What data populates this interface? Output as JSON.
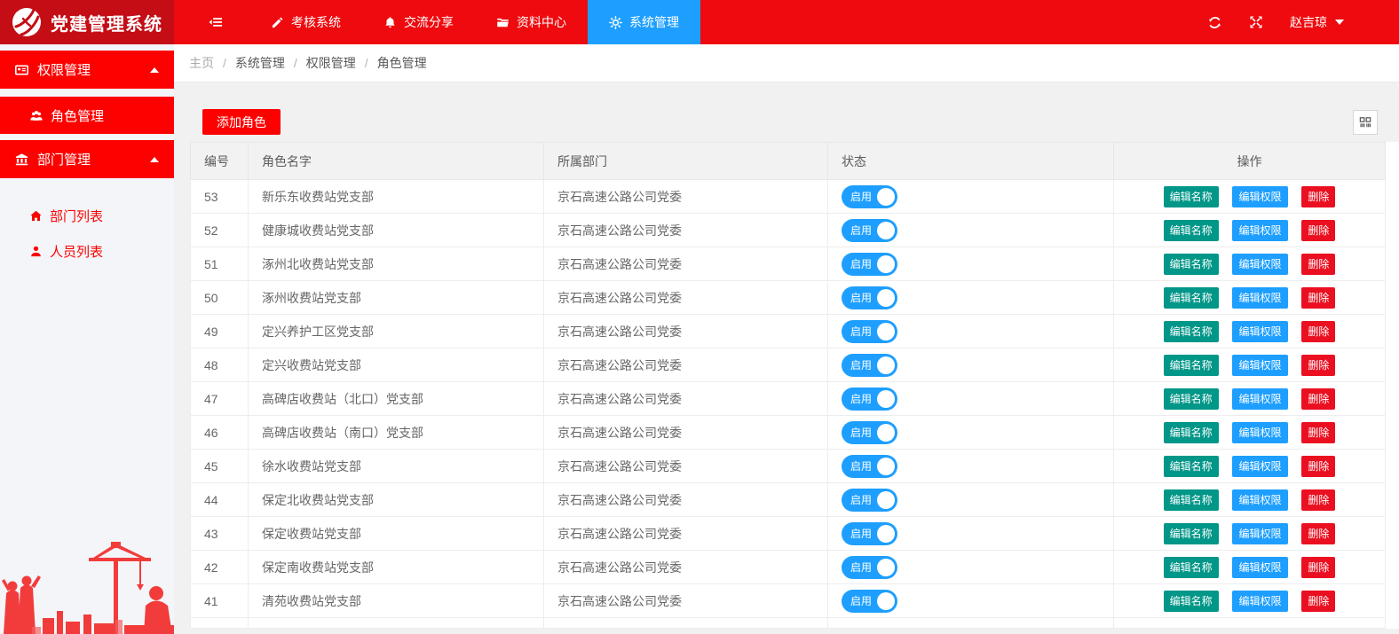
{
  "app": {
    "title": "党建管理系统"
  },
  "colors": {
    "nav_red": "#ee0a0e",
    "logo_red": "#c40d15",
    "menu_red": "#fd0100",
    "active_blue": "#1e9fff",
    "action_green": "#009688",
    "delete_red": "#ea1021"
  },
  "topnav": {
    "items": [
      {
        "label": "考核系统",
        "icon": "pencil-icon",
        "active": false
      },
      {
        "label": "交流分享",
        "icon": "bell-icon",
        "active": false
      },
      {
        "label": "资料中心",
        "icon": "folder-icon",
        "active": false
      },
      {
        "label": "系统管理",
        "icon": "gears-icon",
        "active": true
      }
    ],
    "user": "赵吉琼"
  },
  "sidebar": {
    "groups": [
      {
        "label": "权限管理",
        "icon": "permission-card-icon",
        "expanded": true,
        "children": [
          {
            "label": "角色管理",
            "icon": "users-icon",
            "active": true
          }
        ]
      },
      {
        "label": "部门管理",
        "icon": "bank-icon",
        "expanded": true,
        "children": [
          {
            "label": "部门列表",
            "icon": "home-icon",
            "active": false
          },
          {
            "label": "人员列表",
            "icon": "person-icon",
            "active": false
          }
        ]
      }
    ]
  },
  "breadcrumb": {
    "separator": "/",
    "items": [
      "主页",
      "系统管理",
      "权限管理",
      "角色管理"
    ]
  },
  "toolbar": {
    "add_button": "添加角色"
  },
  "table": {
    "headers": [
      "编号",
      "角色名字",
      "所属部门",
      "状态",
      "操作"
    ],
    "status_on_label": "启用",
    "actions": [
      "编辑名称",
      "编辑权限",
      "删除"
    ],
    "rows": [
      {
        "id": "53",
        "name": "新乐东收费站党支部",
        "dept": "京石高速公路公司党委"
      },
      {
        "id": "52",
        "name": "健康城收费站党支部",
        "dept": "京石高速公路公司党委"
      },
      {
        "id": "51",
        "name": "涿州北收费站党支部",
        "dept": "京石高速公路公司党委"
      },
      {
        "id": "50",
        "name": "涿州收费站党支部",
        "dept": "京石高速公路公司党委"
      },
      {
        "id": "49",
        "name": "定兴养护工区党支部",
        "dept": "京石高速公路公司党委"
      },
      {
        "id": "48",
        "name": "定兴收费站党支部",
        "dept": "京石高速公路公司党委"
      },
      {
        "id": "47",
        "name": "高碑店收费站（北口）党支部",
        "dept": "京石高速公路公司党委"
      },
      {
        "id": "46",
        "name": "高碑店收费站（南口）党支部",
        "dept": "京石高速公路公司党委"
      },
      {
        "id": "45",
        "name": "徐水收费站党支部",
        "dept": "京石高速公路公司党委"
      },
      {
        "id": "44",
        "name": "保定北收费站党支部",
        "dept": "京石高速公路公司党委"
      },
      {
        "id": "43",
        "name": "保定收费站党支部",
        "dept": "京石高速公路公司党委"
      },
      {
        "id": "42",
        "name": "保定南收费站党支部",
        "dept": "京石高速公路公司党委"
      },
      {
        "id": "41",
        "name": "清苑收费站党支部",
        "dept": "京石高速公路公司党委"
      }
    ]
  }
}
